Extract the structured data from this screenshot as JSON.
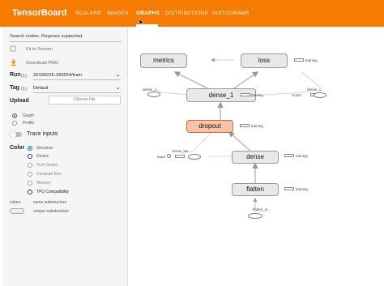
{
  "header": {
    "brand": "TensorBoard",
    "tabs": [
      {
        "label": "SCALARS"
      },
      {
        "label": "IMAGES"
      },
      {
        "label": "GRAPHS"
      },
      {
        "label": "DISTRIBUTIONS"
      },
      {
        "label": "HISTOGRAMS"
      }
    ],
    "brand_color": "#f57c00"
  },
  "sidebar": {
    "search_placeholder": "Search nodes. Regexes supported.",
    "fit_to_screen": "Fit to Screen",
    "download_png": "Download PNG",
    "run_label": "Run",
    "run_count": "(1)",
    "run_value": "20190225-183554/train",
    "tag_label": "Tag",
    "tag_count": "(1)",
    "tag_value": "Default",
    "upload_label": "Upload",
    "choose_file": "Choose File",
    "radio_graph": "Graph",
    "radio_profile": "Profile",
    "trace_inputs": "Trace inputs",
    "color_label": "Color",
    "color_options": [
      "Structure",
      "Device",
      "XLA Cluster",
      "Compute time",
      "Memory",
      "TPU Compatibility"
    ],
    "colors_label": "colors",
    "same_substructure": "same substructure",
    "unique_substructure": "unique substructure",
    "accent_color": "#1565c0"
  },
  "graph": {
    "nodes": {
      "metrics": "metrics",
      "loss": "loss",
      "dense_1": "dense_1",
      "dropout": "dropout",
      "dense": "dense",
      "flatten": "flatten"
    },
    "labels": {
      "training_loss": "training",
      "dense_1_small": "dense_1...",
      "dense_1_training": "training",
      "dense_1_right": "dense_1...",
      "const": "Const",
      "dropout_training": "training",
      "keras_lea": "keras_lea...",
      "input": "input",
      "dense_training": "training",
      "flatten_training": "training",
      "flatten_in": "flatten_in..."
    },
    "dropout_color": "#f7c2a8"
  }
}
